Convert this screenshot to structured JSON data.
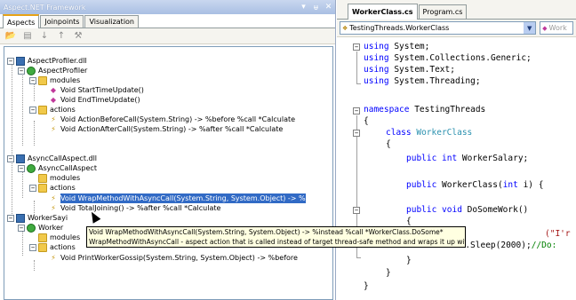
{
  "left_pane": {
    "title": "Aspect.NET Framework",
    "buttons": {
      "dropdown": "▾",
      "pin": "ᵾ",
      "close": "✕"
    },
    "tabs": [
      "Aspects",
      "Joinpoints",
      "Visualization"
    ],
    "active_tab": 0,
    "toolbar_icons": [
      "open-folder-icon",
      "save-icon",
      "move-down-icon",
      "move-up-icon",
      "tools-icon"
    ]
  },
  "tree": {
    "aspect_profiler_dll": "AspectProfiler.dll",
    "aspect_profiler": "AspectProfiler",
    "modules1": "modules",
    "start_time_update": "Void StartTimeUpdate()",
    "end_time_update": "Void EndTimeUpdate()",
    "actions1": "actions",
    "action_before_call": "Void ActionBeforeCall(System.String) -> %before %call *Calculate",
    "action_after_call": "Void ActionAfterCall(System.String) -> %after %call *Calculate",
    "async_call_aspect_dll": "AsyncCallAspect.dll",
    "async_call_aspect": "AsyncCallAspect",
    "modules2": "modules",
    "actions2": "actions",
    "wrap_method": "Void WrapMethodWithAsyncCall(System.String, System.Object) -> %",
    "total_joining": "Void TotalJoining() -> %after %call *Calculate",
    "worker_say_dll": "WorkerSayi",
    "worker_aspect": "Worker",
    "modules3": "modules",
    "actions3": "actions",
    "print_worker_gossip": "Void PrintWorkerGossip(System.String, System.Object) -> %before"
  },
  "tooltip": {
    "line1": "Void WrapMethodWithAsyncCall(System.String, System.Object) -> %instead %call *WorkerClass.DoSome*",
    "line2": "WrapMethodWithAsyncCall - aspect action that is called instead of target thread-safe method and wraps it up with the thread."
  },
  "editor": {
    "tabs": [
      "WorkerClass.cs",
      "Program.cs"
    ],
    "active_tab": 0,
    "class_combo": "TestingThreads.WorkerClass",
    "member_combo": "Work",
    "code": {
      "l1_kw": "using",
      "l1_rest": " System;",
      "l2_kw": "using",
      "l2_rest": " System.Collections.Generic;",
      "l3_kw": "using",
      "l3_rest": " System.Text;",
      "l4_kw": "using",
      "l4_rest": " System.Threading;",
      "l5_kw": "namespace",
      "l5_rest": " TestingThreads",
      "l6": "{",
      "l7_kw": "class",
      "l7_ty": "WorkerClass",
      "l8": "{",
      "l9_kw": "public int",
      "l9_rest": " WorkerSalary;",
      "l10_kw": "public",
      "l10_rest": " WorkerClass(",
      "l10_kw2": "int",
      "l10_rest2": " i) {",
      "l11_kw": "public void",
      "l11_rest": " DoSomeWork()",
      "l12": "{",
      "l13_str": "(\"I'r",
      "l14_ty": "Thread",
      "l14_rest": ".Sleep(2000);",
      "l14_cm": "//Do:",
      "l15": "}",
      "l16": "}",
      "l17": "}"
    }
  }
}
